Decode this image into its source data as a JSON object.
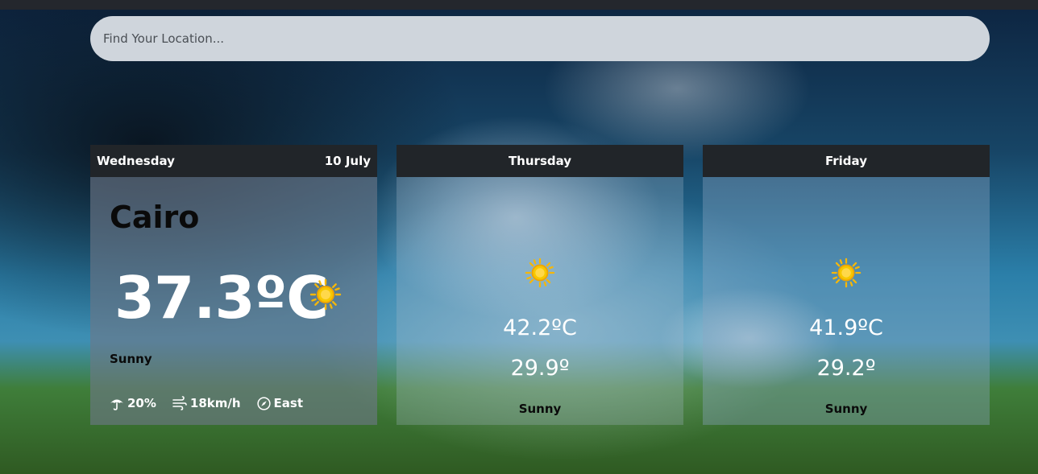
{
  "search": {
    "placeholder": "Find Your Location..."
  },
  "today": {
    "day": "Wednesday",
    "date": "10 July",
    "city": "Cairo",
    "temp": "37.3ºC",
    "condition": "Sunny",
    "icon": "sun-icon",
    "rain": "20%",
    "wind": "18km/h",
    "direction": "East"
  },
  "forecast": [
    {
      "day": "Thursday",
      "max": "42.2ºC",
      "min": "29.9º",
      "condition": "Sunny",
      "icon": "sun-icon"
    },
    {
      "day": "Friday",
      "max": "41.9ºC",
      "min": "29.2º",
      "condition": "Sunny",
      "icon": "sun-icon"
    }
  ],
  "colors": {
    "header": "#212529",
    "search_bg": "#cfd5dc",
    "sun": "#f5c518"
  }
}
